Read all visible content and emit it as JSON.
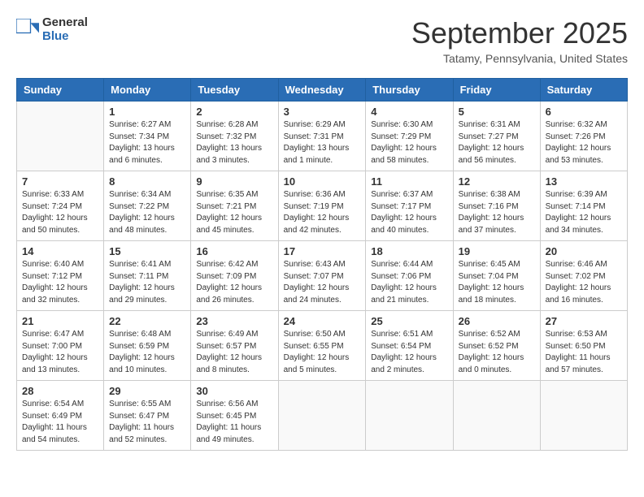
{
  "header": {
    "logo_line1": "General",
    "logo_line2": "Blue",
    "month": "September 2025",
    "location": "Tatamy, Pennsylvania, United States"
  },
  "weekdays": [
    "Sunday",
    "Monday",
    "Tuesday",
    "Wednesday",
    "Thursday",
    "Friday",
    "Saturday"
  ],
  "weeks": [
    [
      {
        "day": "",
        "info": ""
      },
      {
        "day": "1",
        "info": "Sunrise: 6:27 AM\nSunset: 7:34 PM\nDaylight: 13 hours\nand 6 minutes."
      },
      {
        "day": "2",
        "info": "Sunrise: 6:28 AM\nSunset: 7:32 PM\nDaylight: 13 hours\nand 3 minutes."
      },
      {
        "day": "3",
        "info": "Sunrise: 6:29 AM\nSunset: 7:31 PM\nDaylight: 13 hours\nand 1 minute."
      },
      {
        "day": "4",
        "info": "Sunrise: 6:30 AM\nSunset: 7:29 PM\nDaylight: 12 hours\nand 58 minutes."
      },
      {
        "day": "5",
        "info": "Sunrise: 6:31 AM\nSunset: 7:27 PM\nDaylight: 12 hours\nand 56 minutes."
      },
      {
        "day": "6",
        "info": "Sunrise: 6:32 AM\nSunset: 7:26 PM\nDaylight: 12 hours\nand 53 minutes."
      }
    ],
    [
      {
        "day": "7",
        "info": "Sunrise: 6:33 AM\nSunset: 7:24 PM\nDaylight: 12 hours\nand 50 minutes."
      },
      {
        "day": "8",
        "info": "Sunrise: 6:34 AM\nSunset: 7:22 PM\nDaylight: 12 hours\nand 48 minutes."
      },
      {
        "day": "9",
        "info": "Sunrise: 6:35 AM\nSunset: 7:21 PM\nDaylight: 12 hours\nand 45 minutes."
      },
      {
        "day": "10",
        "info": "Sunrise: 6:36 AM\nSunset: 7:19 PM\nDaylight: 12 hours\nand 42 minutes."
      },
      {
        "day": "11",
        "info": "Sunrise: 6:37 AM\nSunset: 7:17 PM\nDaylight: 12 hours\nand 40 minutes."
      },
      {
        "day": "12",
        "info": "Sunrise: 6:38 AM\nSunset: 7:16 PM\nDaylight: 12 hours\nand 37 minutes."
      },
      {
        "day": "13",
        "info": "Sunrise: 6:39 AM\nSunset: 7:14 PM\nDaylight: 12 hours\nand 34 minutes."
      }
    ],
    [
      {
        "day": "14",
        "info": "Sunrise: 6:40 AM\nSunset: 7:12 PM\nDaylight: 12 hours\nand 32 minutes."
      },
      {
        "day": "15",
        "info": "Sunrise: 6:41 AM\nSunset: 7:11 PM\nDaylight: 12 hours\nand 29 minutes."
      },
      {
        "day": "16",
        "info": "Sunrise: 6:42 AM\nSunset: 7:09 PM\nDaylight: 12 hours\nand 26 minutes."
      },
      {
        "day": "17",
        "info": "Sunrise: 6:43 AM\nSunset: 7:07 PM\nDaylight: 12 hours\nand 24 minutes."
      },
      {
        "day": "18",
        "info": "Sunrise: 6:44 AM\nSunset: 7:06 PM\nDaylight: 12 hours\nand 21 minutes."
      },
      {
        "day": "19",
        "info": "Sunrise: 6:45 AM\nSunset: 7:04 PM\nDaylight: 12 hours\nand 18 minutes."
      },
      {
        "day": "20",
        "info": "Sunrise: 6:46 AM\nSunset: 7:02 PM\nDaylight: 12 hours\nand 16 minutes."
      }
    ],
    [
      {
        "day": "21",
        "info": "Sunrise: 6:47 AM\nSunset: 7:00 PM\nDaylight: 12 hours\nand 13 minutes."
      },
      {
        "day": "22",
        "info": "Sunrise: 6:48 AM\nSunset: 6:59 PM\nDaylight: 12 hours\nand 10 minutes."
      },
      {
        "day": "23",
        "info": "Sunrise: 6:49 AM\nSunset: 6:57 PM\nDaylight: 12 hours\nand 8 minutes."
      },
      {
        "day": "24",
        "info": "Sunrise: 6:50 AM\nSunset: 6:55 PM\nDaylight: 12 hours\nand 5 minutes."
      },
      {
        "day": "25",
        "info": "Sunrise: 6:51 AM\nSunset: 6:54 PM\nDaylight: 12 hours\nand 2 minutes."
      },
      {
        "day": "26",
        "info": "Sunrise: 6:52 AM\nSunset: 6:52 PM\nDaylight: 12 hours\nand 0 minutes."
      },
      {
        "day": "27",
        "info": "Sunrise: 6:53 AM\nSunset: 6:50 PM\nDaylight: 11 hours\nand 57 minutes."
      }
    ],
    [
      {
        "day": "28",
        "info": "Sunrise: 6:54 AM\nSunset: 6:49 PM\nDaylight: 11 hours\nand 54 minutes."
      },
      {
        "day": "29",
        "info": "Sunrise: 6:55 AM\nSunset: 6:47 PM\nDaylight: 11 hours\nand 52 minutes."
      },
      {
        "day": "30",
        "info": "Sunrise: 6:56 AM\nSunset: 6:45 PM\nDaylight: 11 hours\nand 49 minutes."
      },
      {
        "day": "",
        "info": ""
      },
      {
        "day": "",
        "info": ""
      },
      {
        "day": "",
        "info": ""
      },
      {
        "day": "",
        "info": ""
      }
    ]
  ]
}
